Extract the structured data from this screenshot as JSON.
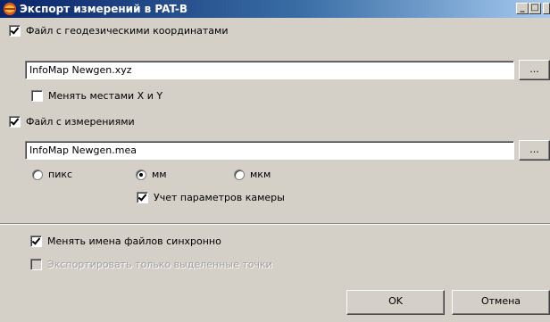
{
  "window": {
    "title": "Экспорт измерений в PAT-B"
  },
  "geo_file": {
    "checkbox_label": "Файл с геодезическими координатами",
    "checked": true,
    "path": "InfoMap Newgen.xyz",
    "browse_label": "...",
    "swap_xy_label": "Менять местами X и Y",
    "swap_xy_checked": false
  },
  "meas_file": {
    "checkbox_label": "Файл с измерениями",
    "checked": true,
    "path": "InfoMap Newgen.mea",
    "browse_label": "...",
    "units": [
      {
        "label": "пикс",
        "selected": false
      },
      {
        "label": "мм",
        "selected": true
      },
      {
        "label": "мкм",
        "selected": false
      }
    ],
    "camera_params_label": "Учет параметров камеры",
    "camera_params_checked": true
  },
  "options": {
    "sync_names_label": "Менять имена файлов синхронно",
    "sync_names_checked": true,
    "export_selected_label": "Экспортировать только выделенные точки",
    "export_selected_checked": false,
    "export_selected_enabled": false
  },
  "buttons": {
    "ok_label": "OK",
    "cancel_label": "Отмена"
  },
  "colors": {
    "title_start": "#0a246a",
    "title_end": "#a6caf0",
    "face": "#d4d0c8"
  }
}
